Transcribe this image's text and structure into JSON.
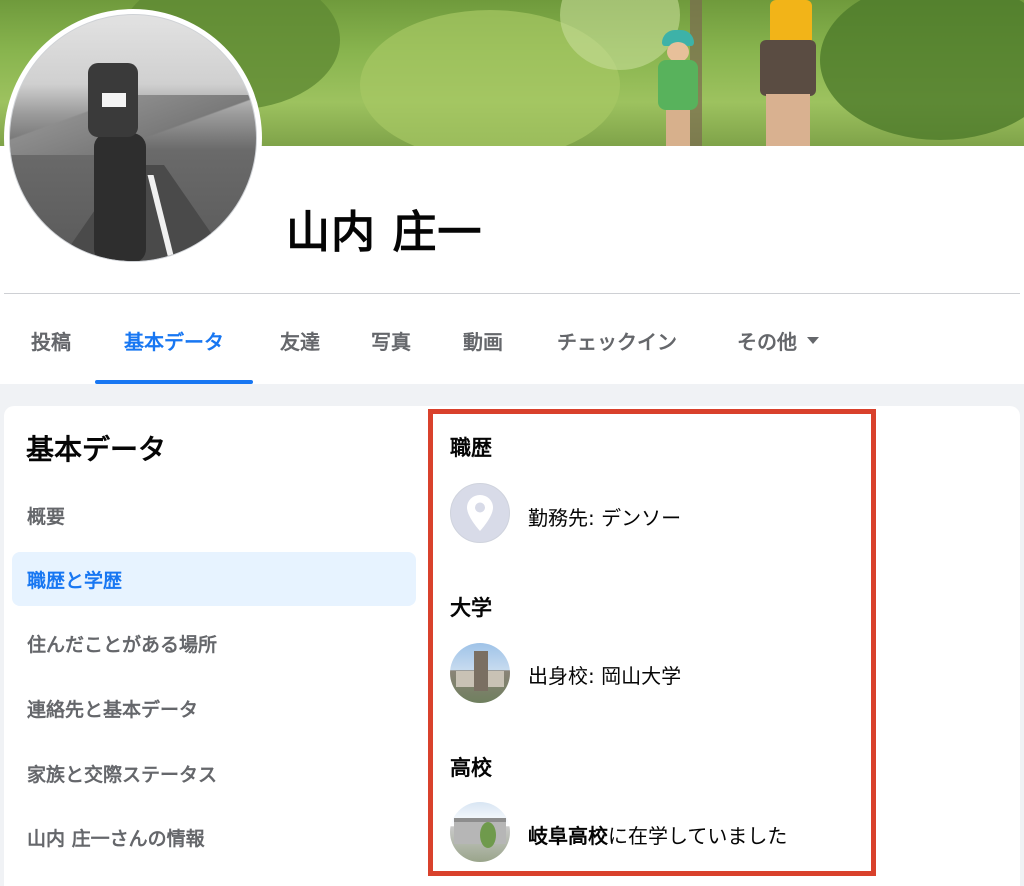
{
  "profile": {
    "name": "山内 庄一"
  },
  "tabs": [
    {
      "label": "投稿",
      "active": false
    },
    {
      "label": "基本データ",
      "active": true
    },
    {
      "label": "友達",
      "active": false
    },
    {
      "label": "写真",
      "active": false
    },
    {
      "label": "動画",
      "active": false
    },
    {
      "label": "チェックイン",
      "active": false
    },
    {
      "label": "その他",
      "active": false
    }
  ],
  "sidebar": {
    "title": "基本データ",
    "items": [
      {
        "label": "概要",
        "active": false
      },
      {
        "label": "職歴と学歴",
        "active": true
      },
      {
        "label": "住んだことがある場所",
        "active": false
      },
      {
        "label": "連絡先と基本データ",
        "active": false
      },
      {
        "label": "家族と交際ステータス",
        "active": false
      },
      {
        "label": "山内 庄一さんの情報",
        "active": false
      }
    ]
  },
  "details": {
    "work": {
      "title": "職歴",
      "icon": "location-pin-icon",
      "text": "勤務先: デンソー"
    },
    "university": {
      "title": "大学",
      "icon": "university-photo",
      "text": "出身校: 岡山大学"
    },
    "high_school": {
      "title": "高校",
      "icon": "high-school-photo",
      "school": "岐阜高校",
      "suffix": "に在学していました"
    }
  },
  "colors": {
    "accent": "#1877f2",
    "highlight_border": "#d9412c",
    "secondary_text": "#65676b"
  }
}
